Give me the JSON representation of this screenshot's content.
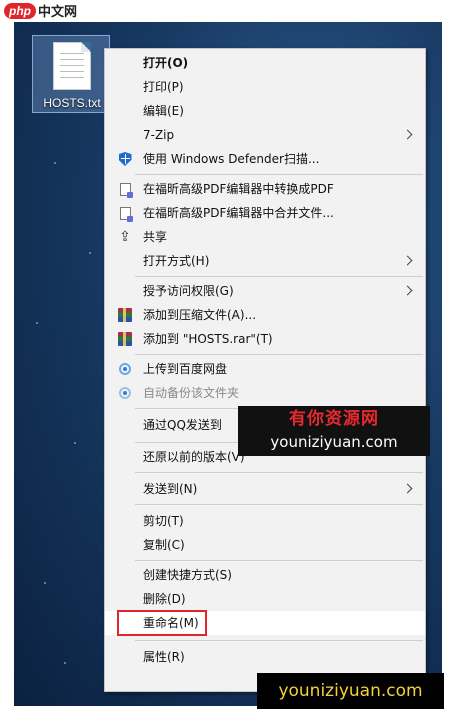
{
  "logo": {
    "php": "php",
    "cn": "中文网"
  },
  "desktop_file": {
    "label": "HOSTS.txt"
  },
  "menu": {
    "open": "打开(O)",
    "print": "打印(P)",
    "edit": "编辑(E)",
    "sevenzip": "7-Zip",
    "defender": "使用 Windows Defender扫描...",
    "pdf_convert": "在福昕高级PDF编辑器中转换成PDF",
    "pdf_merge": "在福昕高级PDF编辑器中合并文件...",
    "share": "共享",
    "open_with": "打开方式(H)",
    "grant_access": "授予访问权限(G)",
    "add_archive": "添加到压缩文件(A)...",
    "add_rar": "添加到 \"HOSTS.rar\"(T)",
    "upload_baidu": "上传到百度网盘",
    "auto_backup": "自动备份该文件夹",
    "send_qq": "通过QQ发送到",
    "restore": "还原以前的版本(V)",
    "send_to": "发送到(N)",
    "cut": "剪切(T)",
    "copy": "复制(C)",
    "shortcut": "创建快捷方式(S)",
    "delete": "删除(D)",
    "rename": "重命名(M)",
    "properties": "属性(R)"
  },
  "watermark": {
    "cn": "有你资源网",
    "url": "youniziyuan.com",
    "url_bottom": "youniziyuan.com"
  },
  "colors": {
    "highlight_box": "#e0262b",
    "menu_bg": "#f2f2f2"
  },
  "icons": {
    "defender": "shield-icon",
    "pdf": "pdf-doc-icon",
    "share": "share-icon",
    "winrar": "winrar-icon",
    "baidu": "baidu-netdisk-icon",
    "submenu": "chevron-right-icon"
  }
}
